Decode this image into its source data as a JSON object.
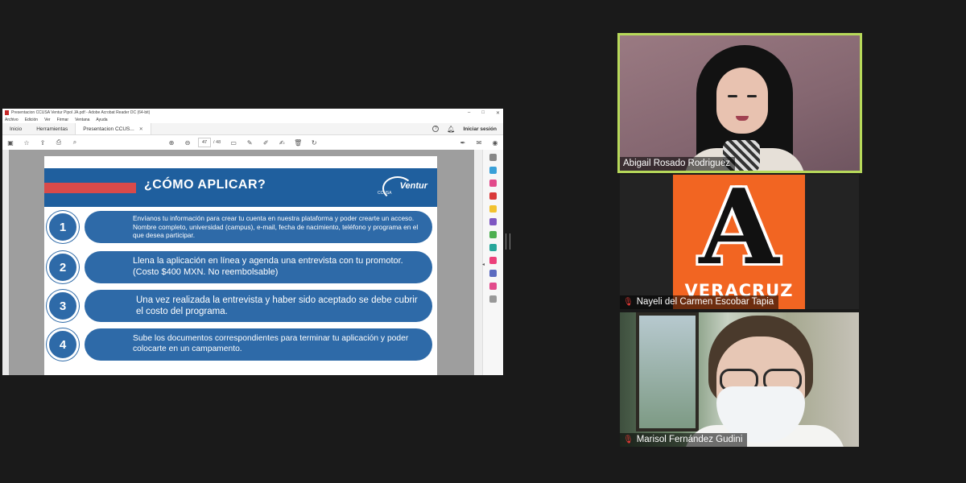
{
  "acrobat": {
    "window_title": "Presentacion CCUSA Ventur Pipol JA.pdf - Adobe Acrobat Reader DC (64-bit)",
    "menu": [
      "Archivo",
      "Edición",
      "Ver",
      "Firmar",
      "Ventana",
      "Ayuda"
    ],
    "tabs": {
      "home": "Inicio",
      "tools": "Herramientas",
      "document": "Presentacion CCUS..."
    },
    "sign_in": "Iniciar sesión",
    "page_current": "47",
    "page_total": "/ 48"
  },
  "slide": {
    "title": "¿CÓMO APLICAR?",
    "logo_brand": "Ventur",
    "logo_sub": "CCUSA",
    "steps": [
      {
        "num": "1",
        "text": "Envíanos tu información para crear tu cuenta en nuestra plataforma y poder crearte un acceso. Nombre completo, universidad (campus), e-mail, fecha de nacimiento, teléfono y programa en el que desea participar."
      },
      {
        "num": "2",
        "text": "Llena la aplicación en línea y agenda una entrevista con tu promotor. (Costo $400 MXN. No reembolsable)"
      },
      {
        "num": "3",
        "text": "Una vez realizada la entrevista y haber sido aceptado se debe cubrir el costo del programa."
      },
      {
        "num": "4",
        "text": "Sube los documentos correspondientes para terminar tu aplicación y poder colocarte en un campamento."
      }
    ]
  },
  "participants": [
    {
      "name": "Abigail Rosado Rodriguez",
      "muted": false,
      "speaking": true
    },
    {
      "name": "Nayeli del Carmen Escobar Tapia",
      "muted": true,
      "logo_letter": "A",
      "logo_word": "VERACRUZ"
    },
    {
      "name": "Marisol Fernández Gudini",
      "muted": true
    }
  ],
  "colors": {
    "background": "#1a1a1a",
    "speaker_border": "#b7d95a",
    "slide_blue": "#1f5f9e",
    "slide_red": "#d94a4a",
    "anahuac_orange": "#f26522"
  }
}
